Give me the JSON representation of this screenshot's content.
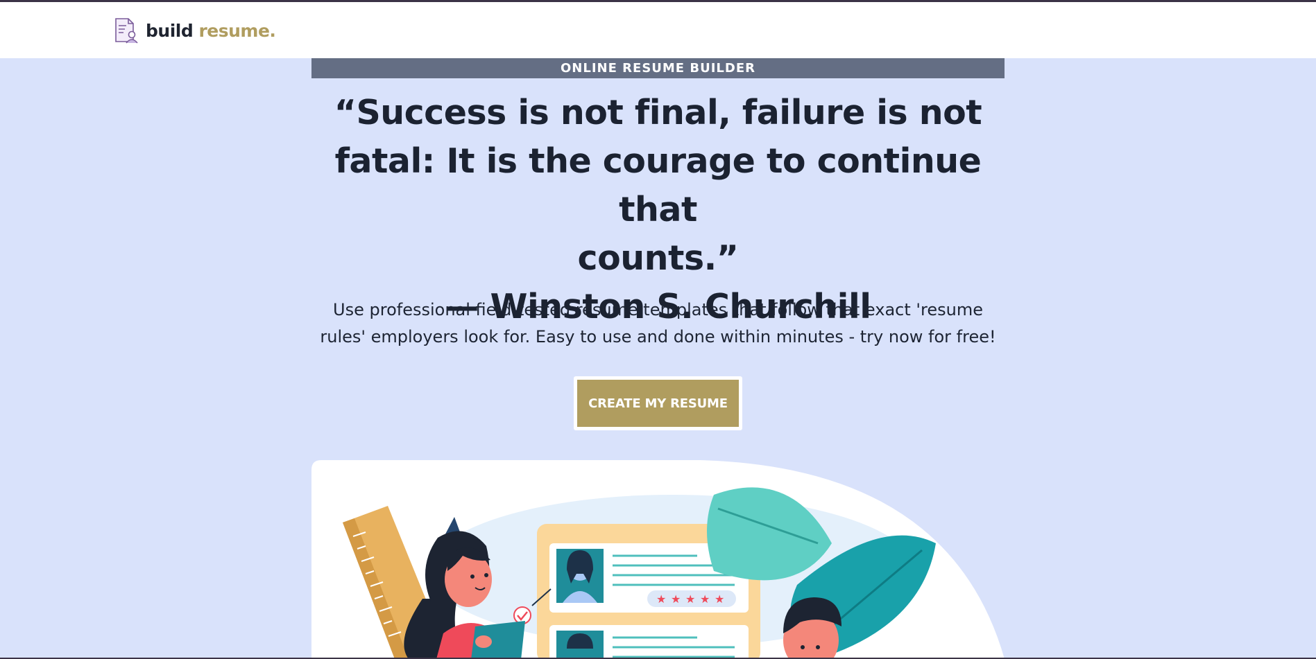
{
  "header": {
    "logo_word_dark": "build",
    "logo_word_accent": "resume.",
    "logo_icon": "resume-person-icon"
  },
  "hero": {
    "eyebrow": "ONLINE RESUME BUILDER",
    "quote_lines": [
      "“Success is not final, failure is not",
      "fatal: It is the courage to continue that",
      "counts.”",
      "— Winston S. Churchill"
    ],
    "description": "Use professional field-tested resume templates that follow that exact 'resume rules' employers look for. Easy to use and done within minutes - try now for free!",
    "cta_label": "CREATE MY RESUME"
  },
  "illustration": {
    "subject": "resume-review-illustration",
    "rating_stars": 5
  },
  "colors": {
    "page_bg": "#d9e2fb",
    "accent_gold": "#b09d5f",
    "eyebrow_bg": "#646e84",
    "text_dark": "#1b2231"
  }
}
